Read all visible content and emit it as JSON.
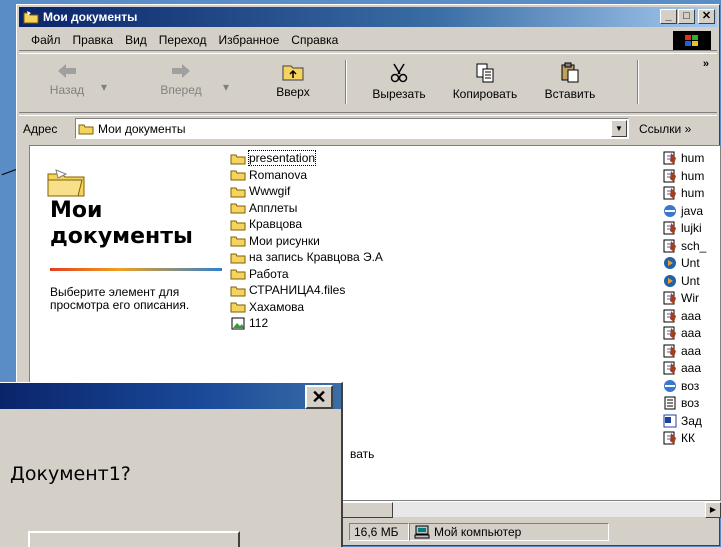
{
  "window": {
    "title": "Мои документы"
  },
  "menu": {
    "items": [
      {
        "label": "Файл"
      },
      {
        "label": "Правка"
      },
      {
        "label": "Вид"
      },
      {
        "label": "Переход"
      },
      {
        "label": "Избранное"
      },
      {
        "label": "Справка"
      }
    ]
  },
  "toolbar": {
    "back": "Назад",
    "forward": "Вперед",
    "up": "Вверх",
    "cut": "Вырезать",
    "copy": "Копировать",
    "paste": "Вставить",
    "more": "»"
  },
  "address": {
    "label": "Адрес",
    "value": "Мои документы",
    "links": "Ссылки »"
  },
  "left_pane": {
    "title_line1": "Мои",
    "title_line2": "документы",
    "description": "Выберите элемент для просмотра его описания."
  },
  "files": [
    "presentation",
    "Romanova",
    "Wwwgif",
    "Апплеты",
    "Кравцова",
    "Мои рисунки",
    "на запись Кравцова Э.А",
    "Работа",
    "СТРАНИЦА4.files",
    "Хахамова",
    "112"
  ],
  "partial_file": "вать",
  "right_files": [
    "hum",
    "hum",
    "hum",
    "java",
    "lujki",
    "sch_",
    "Unt",
    "Unt",
    "Wir",
    "aaa",
    "aaa",
    "aaa",
    "aaa",
    "воз",
    "воз",
    "Зад",
    "КК"
  ],
  "status": {
    "size": "16,6 МБ",
    "location": "Мой компьютер"
  },
  "dialog": {
    "message": "Документ1?",
    "close": "✕"
  },
  "colors": {
    "desktop": "#5a8cc6",
    "titlebar": "#0a246a",
    "folder": "#f4d35e"
  }
}
